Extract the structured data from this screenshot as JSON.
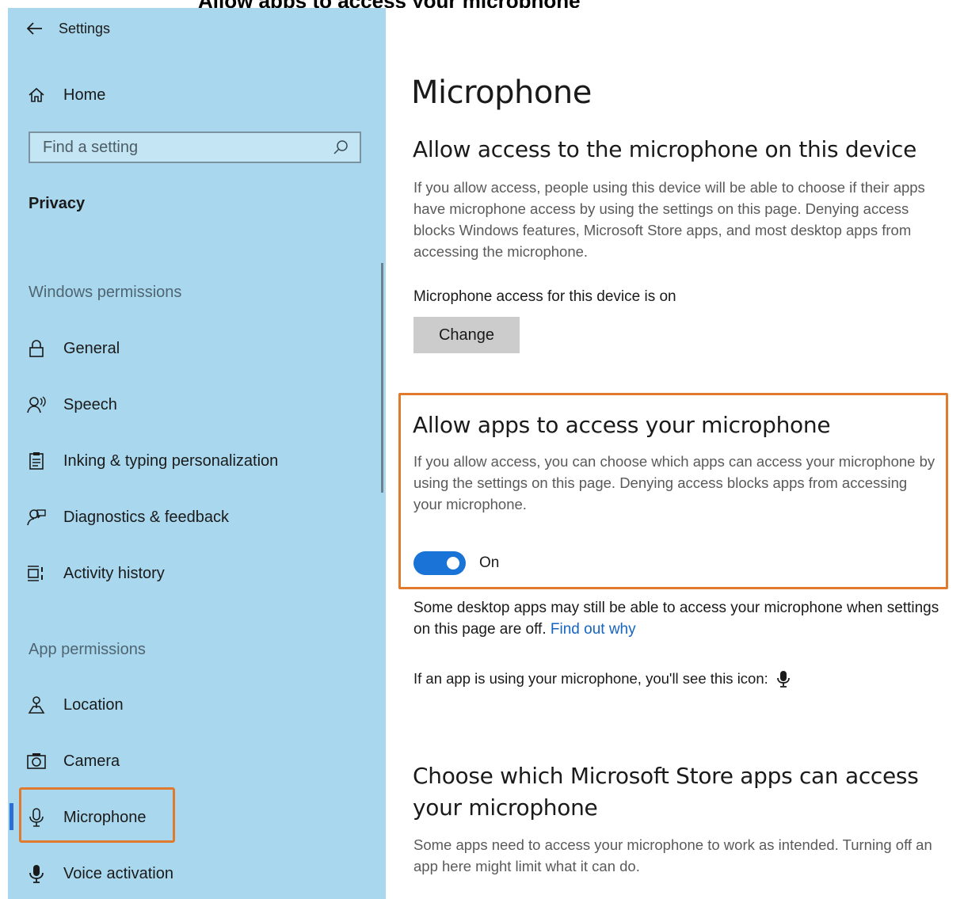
{
  "cropped_heading": "Allow apps to access your microphone",
  "window": {
    "app_title": "Settings"
  },
  "sidebar": {
    "home_label": "Home",
    "search_placeholder": "Find a setting",
    "category_title": "Privacy",
    "windows_permissions_label": "Windows permissions",
    "windows_items": [
      {
        "label": "General",
        "icon": "lock-icon"
      },
      {
        "label": "Speech",
        "icon": "speech-icon"
      },
      {
        "label": "Inking & typing personalization",
        "icon": "clipboard-icon"
      },
      {
        "label": "Diagnostics & feedback",
        "icon": "diagnostics-icon"
      },
      {
        "label": "Activity history",
        "icon": "activity-history-icon"
      }
    ],
    "app_permissions_label": "App permissions",
    "app_items": [
      {
        "label": "Location",
        "icon": "location-icon"
      },
      {
        "label": "Camera",
        "icon": "camera-icon"
      },
      {
        "label": "Microphone",
        "icon": "microphone-icon",
        "selected": true
      },
      {
        "label": "Voice activation",
        "icon": "voice-activation-icon"
      }
    ]
  },
  "main": {
    "page_title": "Microphone",
    "device_section": {
      "heading": "Allow access to the microphone on this device",
      "description": "If you allow access, people using this device will be able to choose if their apps have microphone access by using the settings on this page. Denying access blocks Windows features, Microsoft Store apps, and most desktop apps from accessing the microphone.",
      "status": "Microphone access for this device is on",
      "change_label": "Change"
    },
    "apps_section": {
      "heading": "Allow apps to access your microphone",
      "description": "If you allow access, you can choose which apps can access your microphone by using the settings on this page. Denying access blocks apps from accessing your microphone.",
      "toggle_state": "On",
      "toggle_on": true
    },
    "desktop_note": {
      "text": "Some desktop apps may still be able to access your microphone when settings on this page are off.",
      "link": "Find out why"
    },
    "icon_note": "If an app is using your microphone, you'll see this icon:",
    "store_section": {
      "heading": "Choose which Microsoft Store apps can access your microphone",
      "description": "Some apps need to access your microphone to work as intended. Turning off an app here might limit what it can do."
    }
  },
  "colors": {
    "sidebar_bg": "#a9d8ee",
    "accent": "#1a73d6",
    "highlight": "#e07a2e",
    "link": "#1565c0"
  }
}
